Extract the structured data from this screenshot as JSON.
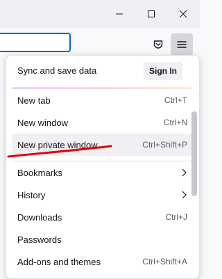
{
  "colors": {
    "accent": "#0061e0",
    "annotation": "#e00000"
  },
  "window_controls": {
    "minimize_icon": "minimize-icon",
    "maximize_icon": "maximize-icon",
    "close_icon": "close-icon"
  },
  "toolbar": {
    "pocket_icon": "pocket-icon",
    "menu_icon": "hamburger-menu-icon"
  },
  "menu": {
    "sync": {
      "label": "Sync and save data",
      "button": "Sign In"
    },
    "items": [
      {
        "label": "New tab",
        "shortcut": "Ctrl+T"
      },
      {
        "label": "New window",
        "shortcut": "Ctrl+N"
      },
      {
        "label": "New private window",
        "shortcut": "Ctrl+Shift+P"
      },
      {
        "label": "Bookmarks",
        "shortcut": ""
      },
      {
        "label": "History",
        "shortcut": ""
      },
      {
        "label": "Downloads",
        "shortcut": "Ctrl+J"
      },
      {
        "label": "Passwords",
        "shortcut": ""
      },
      {
        "label": "Add-ons and themes",
        "shortcut": "Ctrl+Shift+A"
      }
    ]
  }
}
